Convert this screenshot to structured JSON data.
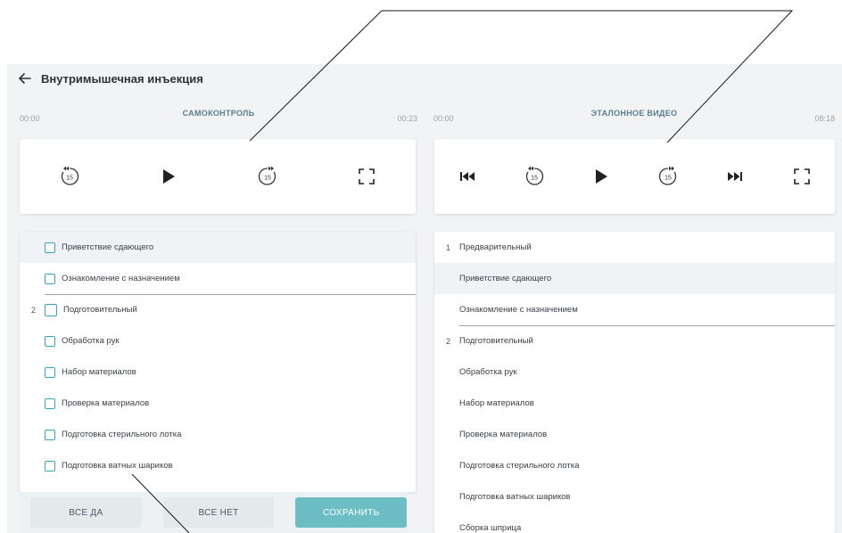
{
  "header": {
    "title": "Внутримышечная инъекция",
    "back_icon": "arrow-left-icon"
  },
  "left_panel": {
    "name": "САМОКОНТРОЛЬ",
    "time_start": "00:00",
    "time_end": "00:23",
    "controls": [
      "rewind-15-icon",
      "play-icon",
      "forward-15-icon",
      "fullscreen-icon"
    ],
    "items": [
      {
        "label": "Приветствие сдающего",
        "num": ""
      },
      {
        "label": "Ознакомление с назначением",
        "num": ""
      },
      {
        "label": "Подготовительный",
        "num": "2"
      },
      {
        "label": "Обработка рук",
        "num": ""
      },
      {
        "label": "Набор материалов",
        "num": ""
      },
      {
        "label": "Проверка материалов",
        "num": ""
      },
      {
        "label": "Подготовка стерильного лотка",
        "num": ""
      },
      {
        "label": "Подготовка ватных шариков",
        "num": ""
      }
    ],
    "buttons": {
      "all_yes": "ВСЕ ДА",
      "all_no": "ВСЕ НЕТ",
      "save": "СОХРАНИТЬ"
    }
  },
  "right_panel": {
    "name": "ЭТАЛОННОЕ ВИДЕО",
    "time_start": "00:00",
    "time_end": "08:18",
    "controls": [
      "skip-back-icon",
      "rewind-15-icon",
      "play-icon",
      "forward-15-icon",
      "skip-forward-icon",
      "fullscreen-icon"
    ],
    "items": [
      {
        "label": "Предварительный",
        "num": "1"
      },
      {
        "label": "Приветствие сдающего",
        "num": ""
      },
      {
        "label": "Ознакомление с назначением",
        "num": ""
      },
      {
        "label": "Подготовительный",
        "num": "2"
      },
      {
        "label": "Обработка рук",
        "num": ""
      },
      {
        "label": "Набор материалов",
        "num": ""
      },
      {
        "label": "Проверка материалов",
        "num": ""
      },
      {
        "label": "Подготовка стерильного лотка",
        "num": ""
      },
      {
        "label": "Подготовка ватных шариков",
        "num": ""
      },
      {
        "label": "Сборка шприца",
        "num": ""
      }
    ]
  },
  "colors": {
    "accent": "#3aa5b8",
    "primary_button": "#6cbdc4",
    "panel_title": "#5b7e91"
  }
}
